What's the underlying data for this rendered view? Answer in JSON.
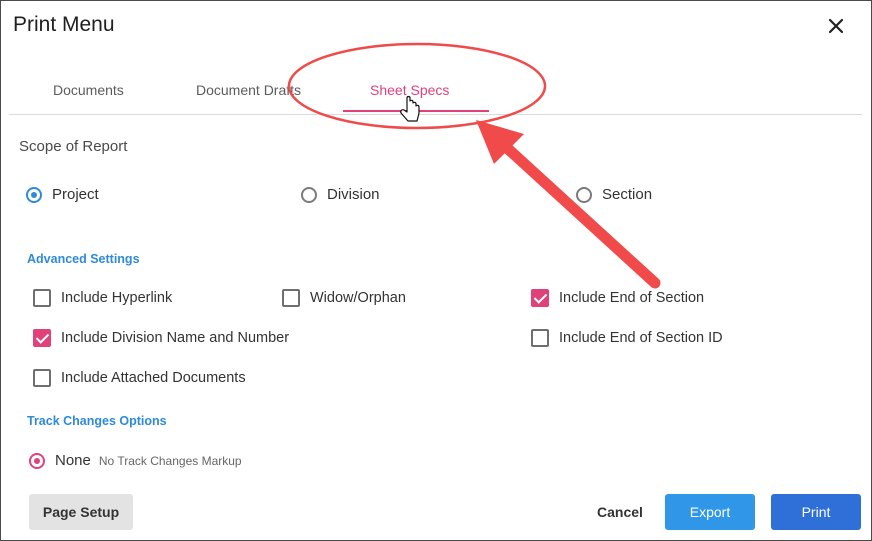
{
  "dialog": {
    "title": "Print Menu",
    "close_icon": "close-icon"
  },
  "tabs": [
    {
      "label": "Documents",
      "active": false
    },
    {
      "label": "Document Drafts",
      "active": false
    },
    {
      "label": "Sheet Specs",
      "active": true
    }
  ],
  "scope": {
    "label": "Scope of Report",
    "options": [
      {
        "label": "Project",
        "selected": true
      },
      {
        "label": "Division",
        "selected": false
      },
      {
        "label": "Section",
        "selected": false
      }
    ]
  },
  "advanced": {
    "heading": "Advanced Settings",
    "options": [
      {
        "label": "Include Hyperlink",
        "checked": false
      },
      {
        "label": "Widow/Orphan",
        "checked": false
      },
      {
        "label": "Include End of Section",
        "checked": true
      },
      {
        "label": "Include Division Name and Number",
        "checked": true
      },
      {
        "label": "Include End of Section ID",
        "checked": false
      },
      {
        "label": "Include Attached Documents",
        "checked": false
      }
    ]
  },
  "track_changes": {
    "heading": "Track Changes Options",
    "option_label": "None",
    "option_sub": "No Track Changes Markup",
    "selected": true
  },
  "buttons": {
    "page_setup": "Page Setup",
    "cancel": "Cancel",
    "export": "Export",
    "print": "Print"
  },
  "colors": {
    "accent_pink": "#e0417a",
    "accent_blue": "#2f8ad8",
    "annotation_red": "#f04a4a"
  }
}
